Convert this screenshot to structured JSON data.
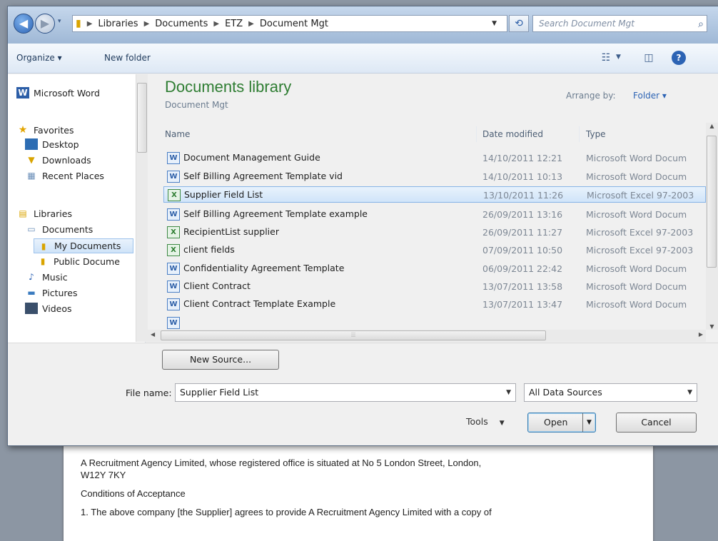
{
  "address": {
    "crumbs": [
      "Libraries",
      "Documents",
      "ETZ",
      "Document Mgt"
    ],
    "search_placeholder": "Search Document Mgt"
  },
  "toolbar": {
    "organize": "Organize ▾",
    "new_folder": "New folder"
  },
  "nav": {
    "app": "Microsoft Word",
    "favorites": "Favorites",
    "desktop": "Desktop",
    "downloads": "Downloads",
    "recent": "Recent Places",
    "libraries": "Libraries",
    "documents": "Documents",
    "my_documents": "My Documents",
    "public_documents": "Public Docume",
    "music": "Music",
    "pictures": "Pictures",
    "videos": "Videos"
  },
  "library": {
    "title": "Documents library",
    "subtitle": "Document Mgt",
    "arrange_label": "Arrange by:",
    "arrange_value": "Folder ▾"
  },
  "columns": {
    "name": "Name",
    "date": "Date modified",
    "type": "Type"
  },
  "files": [
    {
      "name": "Document Management Guide",
      "date": "14/10/2011 12:21",
      "type": "Microsoft Word Docum",
      "kind": "doc"
    },
    {
      "name": "Self Billing Agreement Template vid",
      "date": "14/10/2011 10:13",
      "type": "Microsoft Word Docum",
      "kind": "doc"
    },
    {
      "name": "Supplier Field List",
      "date": "13/10/2011 11:26",
      "type": "Microsoft Excel 97-2003",
      "kind": "xls"
    },
    {
      "name": "Self Billing Agreement Template example",
      "date": "26/09/2011 13:16",
      "type": "Microsoft Word Docum",
      "kind": "doc"
    },
    {
      "name": "RecipientList supplier",
      "date": "26/09/2011 11:27",
      "type": "Microsoft Excel 97-2003",
      "kind": "xls"
    },
    {
      "name": "client fields",
      "date": "07/09/2011 10:50",
      "type": "Microsoft Excel 97-2003",
      "kind": "xls"
    },
    {
      "name": "Confidentiality Agreement Template",
      "date": "06/09/2011 22:42",
      "type": "Microsoft Word Docum",
      "kind": "doc"
    },
    {
      "name": "Client Contract",
      "date": "13/07/2011 13:58",
      "type": "Microsoft Word Docum",
      "kind": "doc"
    },
    {
      "name": "Client Contract Template Example",
      "date": "13/07/2011 13:47",
      "type": "Microsoft Word Docum",
      "kind": "doc"
    }
  ],
  "form": {
    "new_source": "New Source...",
    "file_name_label": "File name:",
    "file_name_value": "Supplier Field List",
    "filter_value": "All Data Sources",
    "tools": "Tools",
    "open": "Open",
    "cancel": "Cancel"
  },
  "document": {
    "line1": "A Recruitment Agency Limited, whose registered office is situated at No 5 London Street, London,",
    "line2": "W12Y 7KY",
    "line3": "Conditions of Acceptance",
    "line4": "1. The above company [the Supplier] agrees to provide A Recruitment Agency Limited with a copy of"
  }
}
